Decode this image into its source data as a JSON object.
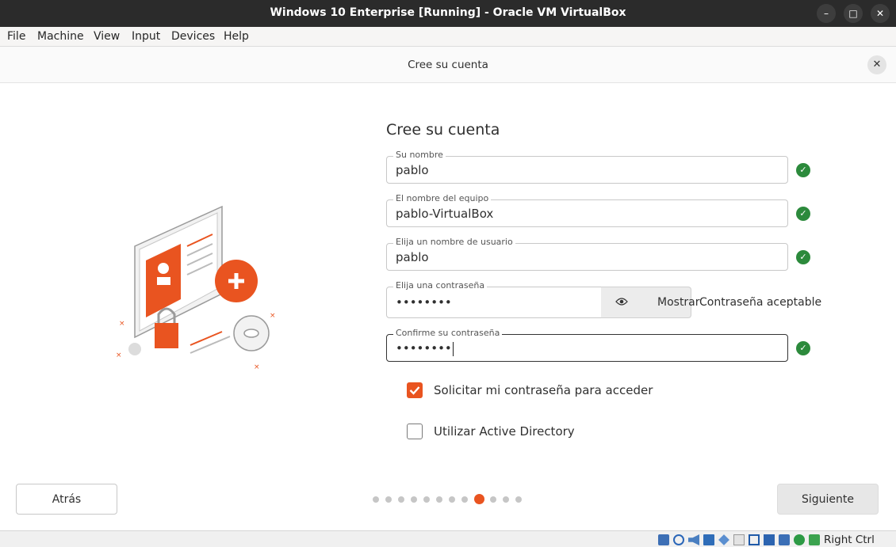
{
  "window": {
    "title": "Windows 10 Enterprise [Running] - Oracle VM VirtualBox",
    "minimize_icon": "minimize-icon",
    "maximize_icon": "maximize-icon",
    "close_icon": "close-icon"
  },
  "menubar": {
    "items": [
      "File",
      "Machine",
      "View",
      "Input",
      "Devices",
      "Help"
    ]
  },
  "installer": {
    "header_title": "Cree su cuenta",
    "heading": "Cree su cuenta",
    "fields": {
      "name": {
        "label": "Su nombre",
        "value": "pablo"
      },
      "hostname": {
        "label": "El nombre del equipo",
        "value": "pablo-VirtualBox"
      },
      "username": {
        "label": "Elija un nombre de usuario",
        "value": "pablo"
      },
      "password": {
        "label": "Elija una contraseña",
        "value": "••••••••"
      },
      "confirm": {
        "label": "Confirme su contraseña",
        "value": "••••••••"
      }
    },
    "show_button": "Mostrar",
    "password_status": "Contraseña aceptable",
    "options": {
      "require_password": {
        "label": "Solicitar mi contraseña para acceder",
        "checked": true
      },
      "active_directory": {
        "label": "Utilizar Active Directory",
        "checked": false
      }
    },
    "back_button": "Atrás",
    "next_button": "Siguiente",
    "progress": {
      "total_steps": 12,
      "current_step": 9
    },
    "accent_color": "#e95420",
    "valid_color": "#2c8a3c"
  },
  "statusbar": {
    "host_key": "Right Ctrl",
    "icons": [
      "hard-disk-icon",
      "optical-drive-icon",
      "audio-icon",
      "network-icon",
      "usb-icon",
      "shared-folder-icon",
      "display-icon",
      "video-capture-icon",
      "cpu-icon",
      "mouse-integration-icon",
      "keyboard-icon"
    ]
  }
}
